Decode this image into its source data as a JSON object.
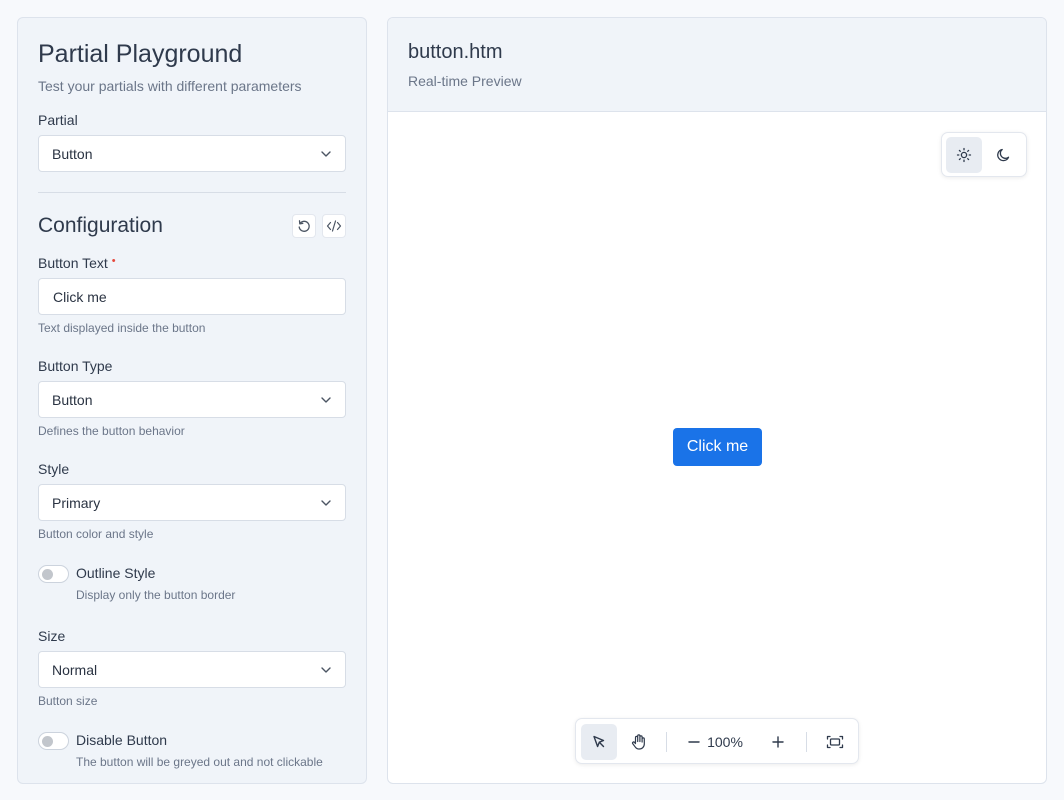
{
  "playground": {
    "title": "Partial Playground",
    "subtitle": "Test your partials with different parameters",
    "partial_label": "Partial",
    "partial_value": "Button"
  },
  "config": {
    "title": "Configuration",
    "reset_icon": "reset-icon",
    "code_icon": "code-icon",
    "button_text": {
      "label": "Button Text",
      "required_mark": "•",
      "value": "Click me",
      "hint": "Text displayed inside the button"
    },
    "button_type": {
      "label": "Button Type",
      "value": "Button",
      "hint": "Defines the button behavior"
    },
    "style": {
      "label": "Style",
      "value": "Primary",
      "hint": "Button color and style"
    },
    "outline": {
      "label": "Outline Style",
      "hint": "Display only the button border",
      "checked": false
    },
    "size": {
      "label": "Size",
      "value": "Normal",
      "hint": "Button size"
    },
    "disable": {
      "label": "Disable Button",
      "hint": "The button will be greyed out and not clickable",
      "checked": false
    }
  },
  "preview": {
    "filename": "button.htm",
    "subtitle": "Real-time Preview",
    "button_label": "Click me",
    "button_color": "#1a73e8",
    "theme_active": "light"
  },
  "toolbar": {
    "zoom": "100%",
    "active_tool": "select"
  }
}
